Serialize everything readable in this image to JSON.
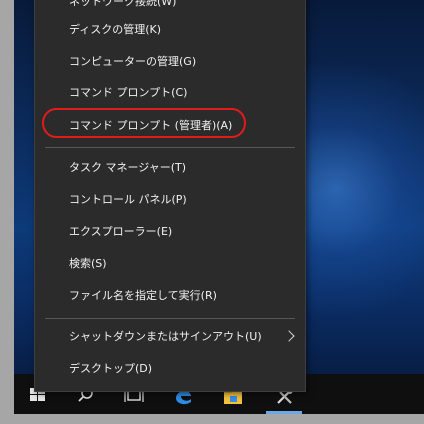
{
  "menu": {
    "items": [
      {
        "id": "network",
        "label": "ネットワーク接続(W)"
      },
      {
        "id": "disk",
        "label": "ディスクの管理(K)"
      },
      {
        "id": "computer-management",
        "label": "コンピューターの管理(G)"
      },
      {
        "id": "cmd",
        "label": "コマンド プロンプト(C)"
      },
      {
        "id": "cmd-admin",
        "label": "コマンド プロンプト (管理者)(A)"
      },
      {
        "id": "task-manager",
        "label": "タスク マネージャー(T)"
      },
      {
        "id": "control-panel",
        "label": "コントロール パネル(P)"
      },
      {
        "id": "explorer",
        "label": "エクスプローラー(E)"
      },
      {
        "id": "search",
        "label": "検索(S)"
      },
      {
        "id": "run",
        "label": "ファイル名を指定して実行(R)"
      },
      {
        "id": "shutdown",
        "label": "シャットダウンまたはサインアウト(U)"
      },
      {
        "id": "desktop",
        "label": "デスクトップ(D)"
      }
    ],
    "submenu_chevron_icon": "chevron-right-icon",
    "highlight_color": "#e21b1b"
  },
  "taskbar": {
    "icons": [
      "windows-start-icon",
      "search-icon",
      "task-view-icon",
      "edge-icon",
      "file-explorer-icon",
      "settings-icon"
    ],
    "active_indicator_color": "#6aa8e8"
  }
}
